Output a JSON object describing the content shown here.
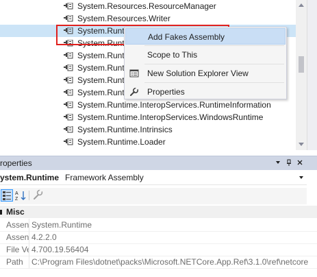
{
  "solution_explorer": {
    "references": [
      {
        "label": "System.Resources.ResourceManager"
      },
      {
        "label": "System.Resources.Writer"
      },
      {
        "label": "System.Runtime",
        "selected": true
      },
      {
        "label": "System.Runt"
      },
      {
        "label": "System.Runt"
      },
      {
        "label": "System.Runt"
      },
      {
        "label": "System.Runt"
      },
      {
        "label": "System.Runt"
      },
      {
        "label": "System.Runtime.InteropServices.RuntimeInformation"
      },
      {
        "label": "System.Runtime.InteropServices.WindowsRuntime"
      },
      {
        "label": "System.Runtime.Intrinsics"
      },
      {
        "label": "System.Runtime.Loader"
      }
    ]
  },
  "context_menu": {
    "items": [
      {
        "label": "Add Fakes Assembly",
        "icon": "none",
        "highlighted": true
      },
      {
        "label": "Scope to This",
        "icon": "none"
      },
      {
        "label": "New Solution Explorer View",
        "icon": "new-view-icon"
      },
      {
        "label": "Properties",
        "icon": "wrench-icon"
      }
    ],
    "highlight_color": "#e0201d"
  },
  "properties_panel": {
    "title": "roperties",
    "object_name": "ystem.Runtime",
    "object_type": "Framework Assembly",
    "category": "Misc",
    "rows": [
      {
        "name": "Assen",
        "value": "System.Runtime"
      },
      {
        "name": "Assen",
        "value": "4.2.2.0"
      },
      {
        "name": "File Ve",
        "value": "4.700.19.56404"
      },
      {
        "name": "Path",
        "value": "C:\\Program Files\\dotnet\\packs\\Microsoft.NETCore.App.Ref\\3.1.0\\ref\\netcore"
      }
    ]
  },
  "colors": {
    "selection": "#cce4f7",
    "menu_hover": "#c9def5",
    "titlebar": "#cfd6e5"
  }
}
